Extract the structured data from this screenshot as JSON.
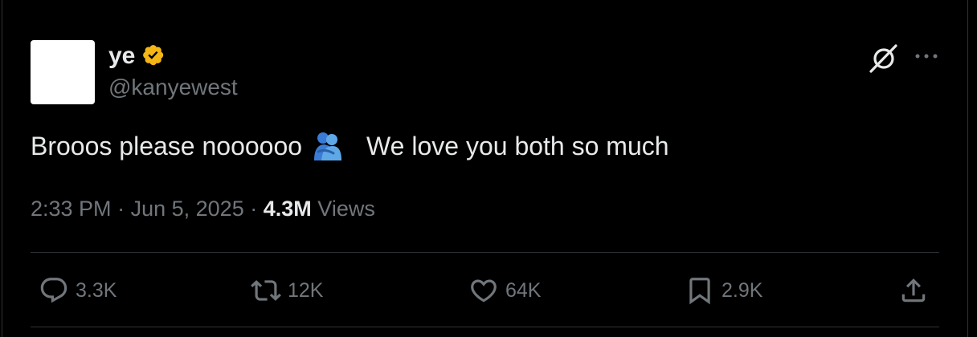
{
  "author": {
    "display_name": "ye",
    "handle": "@kanyewest",
    "verified_badge_color": "#f3b615"
  },
  "tweet": {
    "text_part1": "Brooos please noooooo",
    "emoji": "people-hugging",
    "text_part2": "We love you both so much"
  },
  "meta": {
    "time": "2:33 PM",
    "separator": "·",
    "date": "Jun 5, 2025",
    "views_count": "4.3M",
    "views_label": "Views"
  },
  "actions": {
    "replies": "3.3K",
    "reposts": "12K",
    "likes": "64K",
    "bookmarks": "2.9K"
  },
  "colors": {
    "background": "#000000",
    "text": "#e7e9ea",
    "secondary": "#71767b",
    "divider": "#2f3336"
  }
}
